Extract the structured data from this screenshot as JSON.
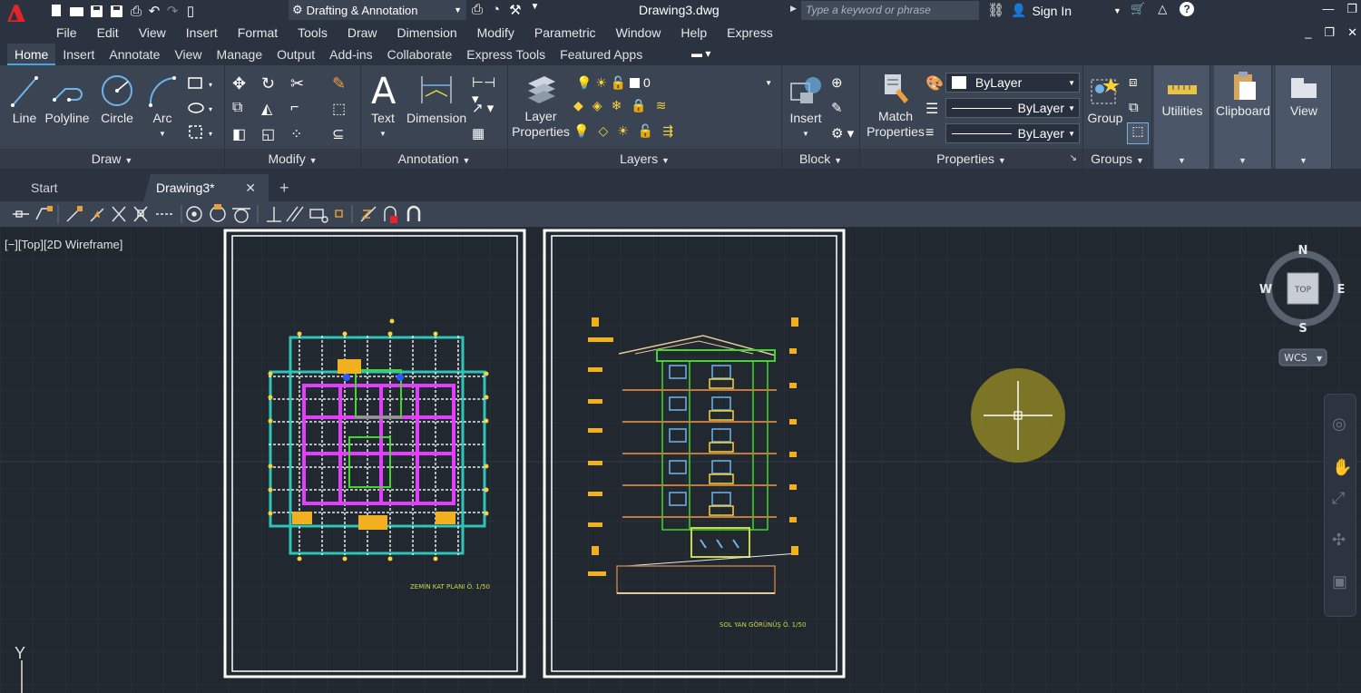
{
  "titlebar": {
    "workspace": "Drafting & Annotation",
    "title": "Drawing3.dwg",
    "search_placeholder": "Type a keyword or phrase",
    "sign_in": "Sign In"
  },
  "menu": [
    "File",
    "Edit",
    "View",
    "Insert",
    "Format",
    "Tools",
    "Draw",
    "Dimension",
    "Modify",
    "Parametric",
    "Window",
    "Help",
    "Express"
  ],
  "ribbon_tabs": [
    "Home",
    "Insert",
    "Annotate",
    "View",
    "Manage",
    "Output",
    "Add-ins",
    "Collaborate",
    "Express Tools",
    "Featured Apps"
  ],
  "ribbon": {
    "draw": {
      "line": "Line",
      "polyline": "Polyline",
      "circle": "Circle",
      "arc": "Arc",
      "footer": "Draw"
    },
    "modify": {
      "footer": "Modify"
    },
    "annotation": {
      "text": "Text",
      "dimension": "Dimension",
      "footer": "Annotation"
    },
    "layers": {
      "layer_properties_1": "Layer",
      "layer_properties_2": "Properties",
      "current_layer": "0",
      "footer": "Layers"
    },
    "block": {
      "insert": "Insert",
      "footer": "Block"
    },
    "properties": {
      "match_1": "Match",
      "match_2": "Properties",
      "color": "ByLayer",
      "linetype": "ByLayer",
      "lineweight": "ByLayer",
      "footer": "Properties"
    },
    "groups": {
      "group": "Group",
      "footer": "Groups"
    },
    "utilities": "Utilities",
    "clipboard": "Clipboard",
    "view": "View"
  },
  "doc_tabs": {
    "start": "Start",
    "active": "Drawing3*"
  },
  "viewport": {
    "controls": "[−][Top][2D Wireframe]",
    "plan_label": "ZEMİN KAT PLANI Ö. 1/50",
    "elevation_label": "SOL YAN GÖRÜNÜŞ Ö. 1/50",
    "ucs_axis": "Y"
  },
  "viewcube": {
    "n": "N",
    "s": "S",
    "e": "E",
    "w": "W",
    "face": "TOP",
    "wcs": "WCS"
  },
  "colors": {
    "accent": "#4aa3df",
    "canvas": "#212830",
    "ribbon": "#3b4453",
    "bar": "#2b3340",
    "logo": "#e3242b"
  }
}
